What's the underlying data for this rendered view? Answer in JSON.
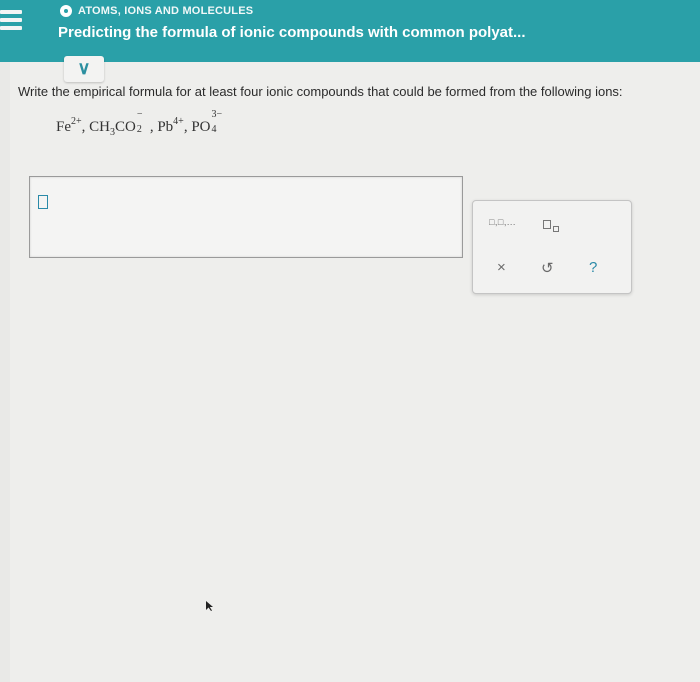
{
  "header": {
    "topic": "ATOMS, IONS AND MOLECULES",
    "lesson_title": "Predicting the formula of ionic compounds with common polyat..."
  },
  "expand_tab": {
    "icon": "chevron-down-icon",
    "glyph": "∨"
  },
  "question": {
    "prompt": "Write the empirical formula for at least four ionic compounds that could be formed from the following ions:"
  },
  "ions": {
    "fe": {
      "base": "Fe",
      "charge": "2+"
    },
    "sep1": ", ",
    "acetate": {
      "ch": "CH",
      "sub3": "3",
      "co": "CO",
      "charge": "−",
      "sub2": "2"
    },
    "sep2": ", ",
    "pb": {
      "base": "Pb",
      "charge": "4+"
    },
    "sep3": ", ",
    "po": {
      "base": "PO",
      "charge": "3−",
      "sub4": "4"
    }
  },
  "toolbar": {
    "separator_label": "□,□,...",
    "subscript_label": "□□",
    "clear_glyph": "×",
    "undo_glyph": "↺",
    "help_glyph": "?"
  },
  "colors": {
    "header_bg": "#2aa0a8",
    "accent": "#2a8aa8"
  }
}
